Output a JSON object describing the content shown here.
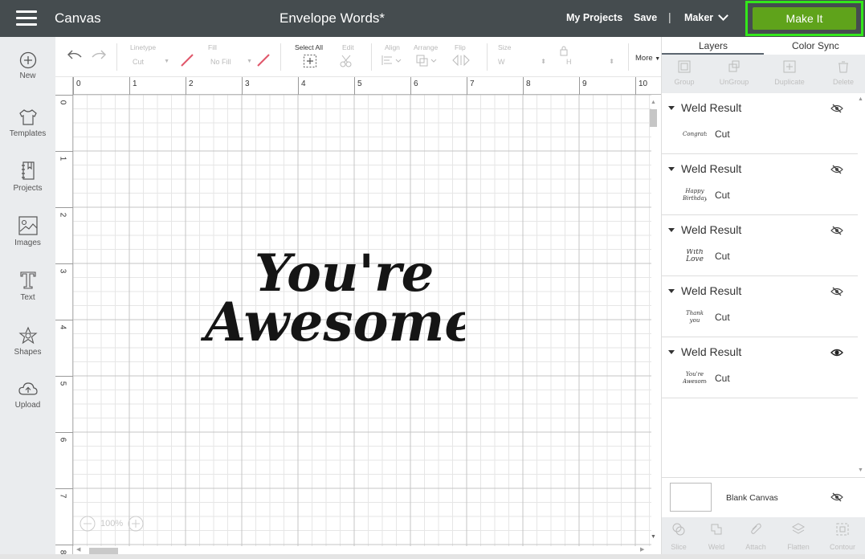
{
  "header": {
    "app_title": "Canvas",
    "document_title": "Envelope Words*",
    "my_projects": "My Projects",
    "save": "Save",
    "separator": "|",
    "machine": "Maker",
    "make_it": "Make It",
    "accent_color": "#5fa31b",
    "highlight_color": "#33e61b"
  },
  "sidebar": {
    "items": [
      {
        "label": "New",
        "icon": "plus-circle-icon"
      },
      {
        "label": "Templates",
        "icon": "tshirt-icon"
      },
      {
        "label": "Projects",
        "icon": "notebook-icon"
      },
      {
        "label": "Images",
        "icon": "image-icon"
      },
      {
        "label": "Text",
        "icon": "text-icon"
      },
      {
        "label": "Shapes",
        "icon": "shapes-icon"
      },
      {
        "label": "Upload",
        "icon": "upload-cloud-icon"
      }
    ]
  },
  "toolbar": {
    "linetype_label": "Linetype",
    "linetype_value": "Cut",
    "fill_label": "Fill",
    "fill_value": "No Fill",
    "select_all": "Select All",
    "edit": "Edit",
    "align": "Align",
    "arrange": "Arrange",
    "flip": "Flip",
    "size": "Size",
    "w": "W",
    "h": "H",
    "more": "More"
  },
  "canvas": {
    "ruler_top": [
      "0",
      "1",
      "2",
      "3",
      "4",
      "5",
      "6",
      "7",
      "8",
      "9",
      "10"
    ],
    "ruler_left": [
      "0",
      "1",
      "2",
      "3",
      "4",
      "5",
      "6",
      "7",
      "8"
    ],
    "text_line1": "You're",
    "text_line2": "Awesome",
    "zoom": "100%"
  },
  "panel": {
    "tabs": [
      "Layers",
      "Color Sync"
    ],
    "actions": [
      "Group",
      "UnGroup",
      "Duplicate",
      "Delete"
    ],
    "layers": [
      {
        "title": "Weld Result",
        "thumb": "Congrats!",
        "type": "Cut",
        "visible": false
      },
      {
        "title": "Weld Result",
        "thumb": "Happy Birthday",
        "type": "Cut",
        "visible": false
      },
      {
        "title": "Weld Result",
        "thumb": "With Love",
        "type": "Cut",
        "visible": false
      },
      {
        "title": "Weld Result",
        "thumb": "Thank you",
        "type": "Cut",
        "visible": false
      },
      {
        "title": "Weld Result",
        "thumb": "You're Awesome",
        "type": "Cut",
        "visible": true
      }
    ],
    "blank_canvas": "Blank Canvas",
    "bottom_actions": [
      "Slice",
      "Weld",
      "Attach",
      "Flatten",
      "Contour"
    ]
  }
}
